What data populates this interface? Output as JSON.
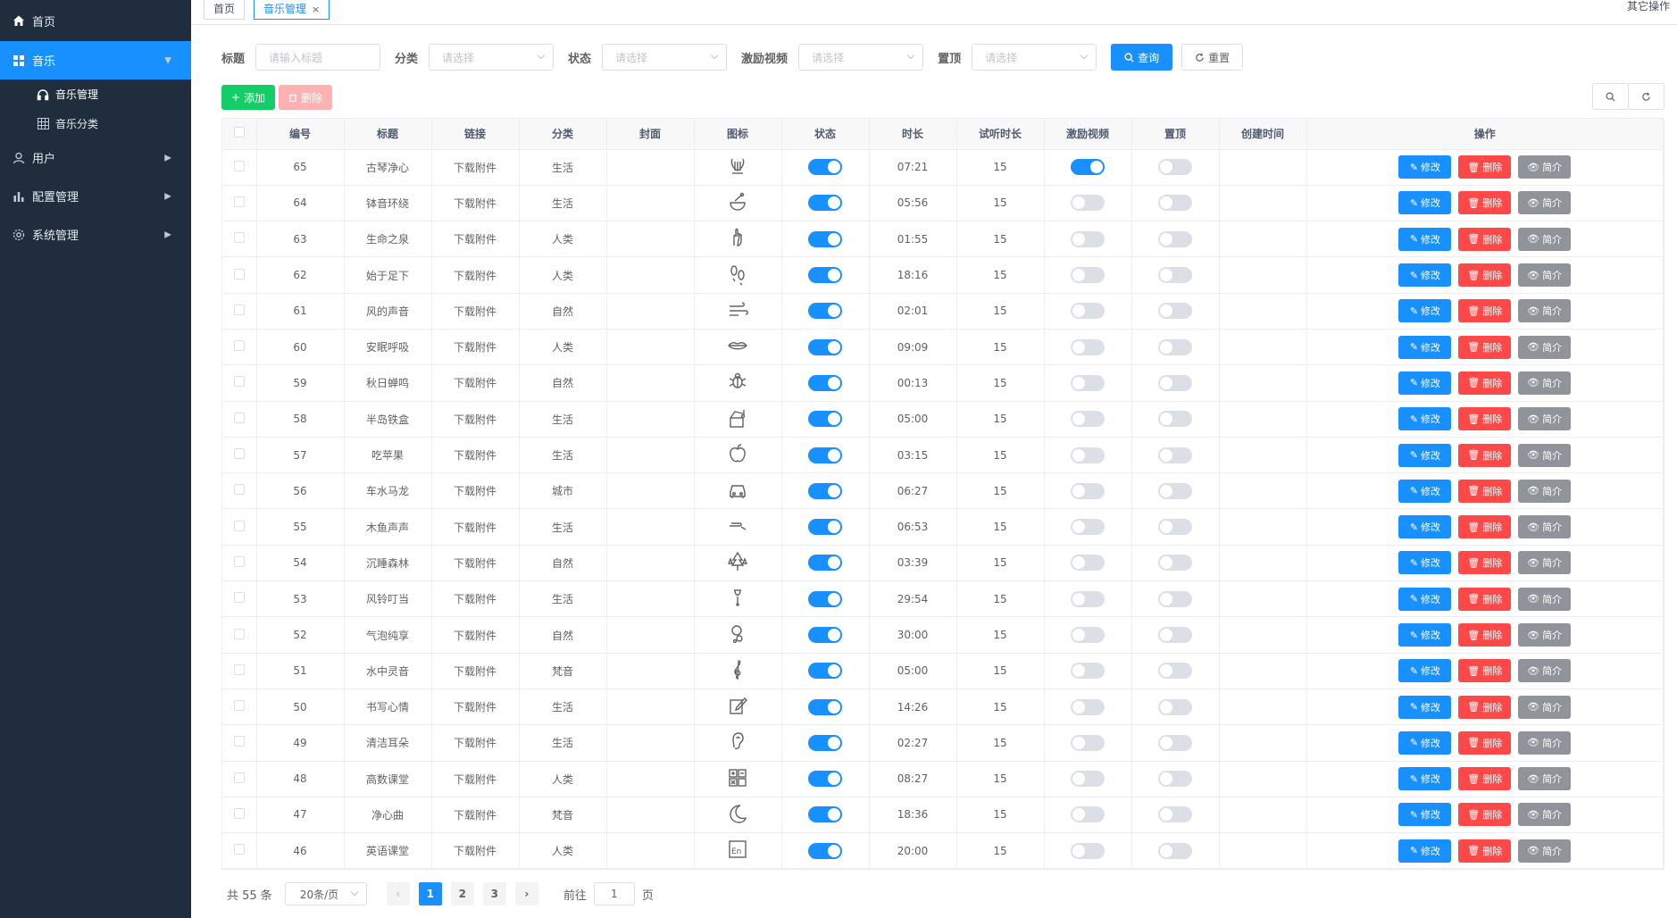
{
  "sidebar": {
    "items": [
      {
        "label": "首页",
        "icon": "home-icon"
      },
      {
        "label": "音乐",
        "icon": "grid-icon",
        "active": true,
        "children": [
          {
            "label": "音乐管理",
            "icon": "headphones-icon"
          },
          {
            "label": "音乐分类",
            "icon": "table-icon"
          }
        ]
      },
      {
        "label": "用户",
        "icon": "user-icon"
      },
      {
        "label": "配置管理",
        "icon": "bar-chart-icon"
      },
      {
        "label": "系统管理",
        "icon": "gear-icon"
      }
    ]
  },
  "tabs": {
    "home": "首页",
    "music": "音乐管理",
    "close": "×",
    "other_ops": "其它操作"
  },
  "search": {
    "title_label": "标题",
    "title_placeholder": "请输入标题",
    "category_label": "分类",
    "category_placeholder": "请选择",
    "status_label": "状态",
    "status_placeholder": "请选择",
    "video_label": "激励视频",
    "video_placeholder": "请选择",
    "top_label": "置顶",
    "top_placeholder": "请选择",
    "query_btn": "查询",
    "reset_btn": "重置"
  },
  "toolbar": {
    "add_btn": "添加",
    "delete_btn": "删除"
  },
  "table": {
    "headers": [
      "编号",
      "标题",
      "链接",
      "分类",
      "封面",
      "图标",
      "状态",
      "时长",
      "试听时长",
      "激励视频",
      "置顶",
      "创建时间",
      "操作"
    ],
    "op_labels": {
      "edit": "修改",
      "delete": "删除",
      "info": "简介"
    },
    "rows": [
      {
        "id": "65",
        "title": "古琴净心",
        "link": "下载附件",
        "category": "生活",
        "icon": "lyre-icon",
        "status": true,
        "duration": "07:21",
        "trial": "15",
        "video": true,
        "top": false
      },
      {
        "id": "64",
        "title": "钵音环绕",
        "link": "下载附件",
        "category": "生活",
        "icon": "bowl-icon",
        "status": true,
        "duration": "05:56",
        "trial": "15",
        "video": false,
        "top": false
      },
      {
        "id": "63",
        "title": "生命之泉",
        "link": "下载附件",
        "category": "人类",
        "icon": "hand-icon",
        "status": true,
        "duration": "01:55",
        "trial": "15",
        "video": false,
        "top": false
      },
      {
        "id": "62",
        "title": "始于足下",
        "link": "下载附件",
        "category": "人类",
        "icon": "footprints-icon",
        "status": true,
        "duration": "18:16",
        "trial": "15",
        "video": false,
        "top": false
      },
      {
        "id": "61",
        "title": "风的声音",
        "link": "下载附件",
        "category": "自然",
        "icon": "wind-icon",
        "status": true,
        "duration": "02:01",
        "trial": "15",
        "video": false,
        "top": false
      },
      {
        "id": "60",
        "title": "安眠呼吸",
        "link": "下载附件",
        "category": "人类",
        "icon": "lips-icon",
        "status": true,
        "duration": "09:09",
        "trial": "15",
        "video": false,
        "top": false
      },
      {
        "id": "59",
        "title": "秋日蝉鸣",
        "link": "下载附件",
        "category": "自然",
        "icon": "bug-icon",
        "status": true,
        "duration": "00:13",
        "trial": "15",
        "video": false,
        "top": false
      },
      {
        "id": "58",
        "title": "半岛铁盒",
        "link": "下载附件",
        "category": "生活",
        "icon": "music-box-icon",
        "status": true,
        "duration": "05:00",
        "trial": "15",
        "video": false,
        "top": false
      },
      {
        "id": "57",
        "title": "吃苹果",
        "link": "下载附件",
        "category": "生活",
        "icon": "apple-icon",
        "status": true,
        "duration": "03:15",
        "trial": "15",
        "video": false,
        "top": false
      },
      {
        "id": "56",
        "title": "车水马龙",
        "link": "下载附件",
        "category": "城市",
        "icon": "car-icon",
        "status": true,
        "duration": "06:27",
        "trial": "15",
        "video": false,
        "top": false
      },
      {
        "id": "55",
        "title": "木鱼声声",
        "link": "下载附件",
        "category": "生活",
        "icon": "wooden-fish-icon",
        "status": true,
        "duration": "06:53",
        "trial": "15",
        "video": false,
        "top": false
      },
      {
        "id": "54",
        "title": "沉睡森林",
        "link": "下载附件",
        "category": "自然",
        "icon": "trees-icon",
        "status": true,
        "duration": "03:39",
        "trial": "15",
        "video": false,
        "top": false
      },
      {
        "id": "53",
        "title": "风铃叮当",
        "link": "下载附件",
        "category": "生活",
        "icon": "wind-chime-icon",
        "status": true,
        "duration": "29:54",
        "trial": "15",
        "video": false,
        "top": false
      },
      {
        "id": "52",
        "title": "气泡纯享",
        "link": "下载附件",
        "category": "自然",
        "icon": "bubbles-icon",
        "status": true,
        "duration": "30:00",
        "trial": "15",
        "video": false,
        "top": false
      },
      {
        "id": "51",
        "title": "水中灵音",
        "link": "下载附件",
        "category": "梵音",
        "icon": "treble-clef-icon",
        "status": true,
        "duration": "05:00",
        "trial": "15",
        "video": false,
        "top": false
      },
      {
        "id": "50",
        "title": "书写心情",
        "link": "下载附件",
        "category": "生活",
        "icon": "pen-icon",
        "status": true,
        "duration": "14:26",
        "trial": "15",
        "video": false,
        "top": false
      },
      {
        "id": "49",
        "title": "清洁耳朵",
        "link": "下载附件",
        "category": "生活",
        "icon": "ear-icon",
        "status": true,
        "duration": "02:27",
        "trial": "15",
        "video": false,
        "top": false
      },
      {
        "id": "48",
        "title": "高数课堂",
        "link": "下载附件",
        "category": "人类",
        "icon": "calculator-icon",
        "status": true,
        "duration": "08:27",
        "trial": "15",
        "video": false,
        "top": false
      },
      {
        "id": "47",
        "title": "净心曲",
        "link": "下载附件",
        "category": "梵音",
        "icon": "moon-icon",
        "status": true,
        "duration": "18:36",
        "trial": "15",
        "video": false,
        "top": false
      },
      {
        "id": "46",
        "title": "英语课堂",
        "link": "下载附件",
        "category": "人类",
        "icon": "english-icon",
        "status": true,
        "duration": "20:00",
        "trial": "15",
        "video": false,
        "top": false
      }
    ]
  },
  "pagination": {
    "total": "共 55 条",
    "page_size": "20条/页",
    "pages": [
      "1",
      "2",
      "3"
    ],
    "current": "1",
    "goto_label": "前往",
    "goto_value": "1",
    "page_suffix": "页"
  },
  "colors": {
    "sidebar_bg": "#1f2d3d",
    "primary": "#1890ff",
    "danger": "#ff4949",
    "success": "#13ce66",
    "info": "#909399"
  }
}
